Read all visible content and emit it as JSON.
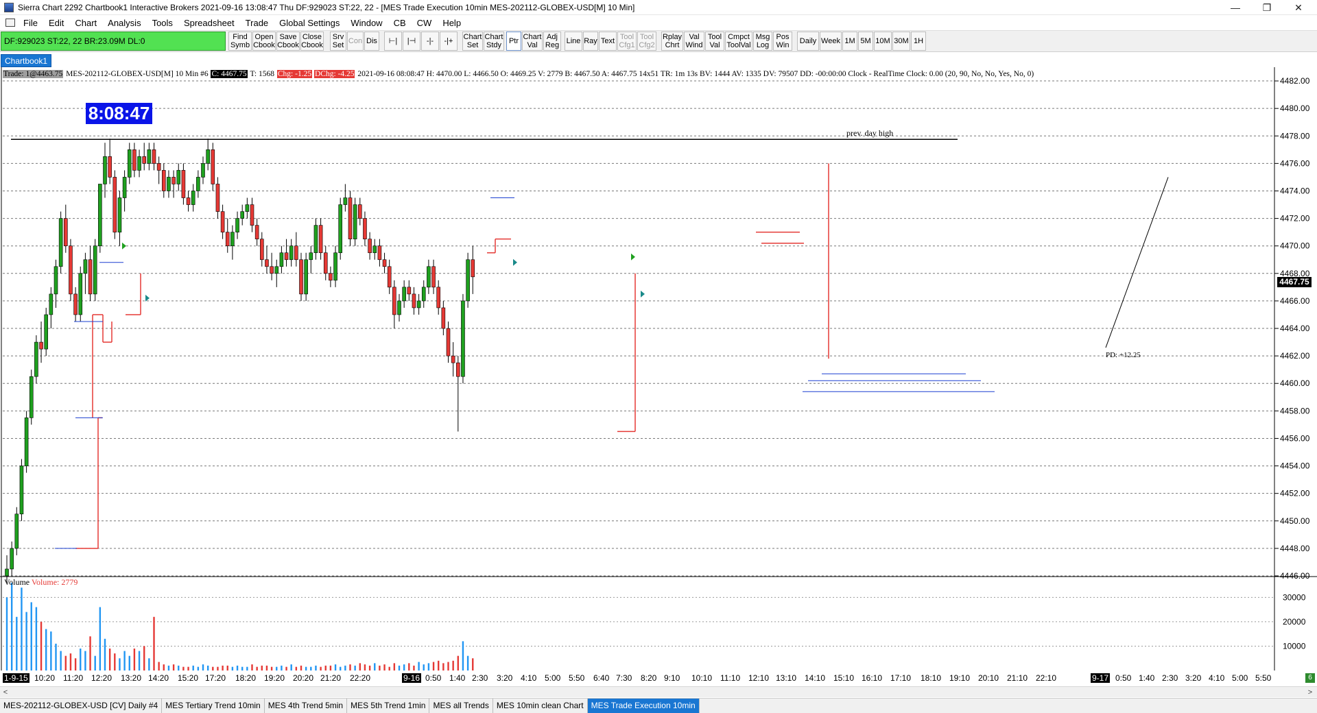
{
  "window": {
    "title": "Sierra Chart 2292 Chartbook1  Interactive Brokers 2021-09-16  13:08:47 Thu  DF:929023  ST:22, 22 - [MES Trade Execution 10min MES-202112-GLOBEX-USD[M]  10 Min]",
    "minimize": "—",
    "restore": "❐",
    "close": "✕"
  },
  "menu": [
    "File",
    "Edit",
    "Chart",
    "Analysis",
    "Tools",
    "Spreadsheet",
    "Trade",
    "Global Settings",
    "Window",
    "CB",
    "CW",
    "Help"
  ],
  "toolbar": {
    "status": "DF:929023  ST:22, 22  BR:23.09M  DL:0",
    "buttons": [
      {
        "label": "Find\nSymb"
      },
      {
        "label": "Open\nCbook"
      },
      {
        "label": "Save\nCbook"
      },
      {
        "label": "Close\nCbook"
      },
      {
        "label": "Srv\nSet"
      },
      {
        "label": "Con",
        "disabled": true
      },
      {
        "label": "Dis"
      },
      {
        "label": "⊢|",
        "icon": "zoom-left-icon"
      },
      {
        "label": "|⊣",
        "icon": "zoom-right-icon"
      },
      {
        "label": "-|-",
        "icon": "scroll-center-icon"
      },
      {
        "label": "-|+",
        "icon": "scroll-right-icon"
      },
      {
        "label": "Chart\nSet"
      },
      {
        "label": "Chart\nStdy"
      },
      {
        "label": "Ptr",
        "selected": true
      },
      {
        "label": "Chart\nVal"
      },
      {
        "label": "Adj\nReg"
      },
      {
        "label": "Line"
      },
      {
        "label": "Ray"
      },
      {
        "label": "Text"
      },
      {
        "label": "Tool\nCfg1",
        "disabled": true
      },
      {
        "label": "Tool\nCfg2",
        "disabled": true
      },
      {
        "label": "Rplay\nChrt"
      },
      {
        "label": "Val\nWind"
      },
      {
        "label": "Tool\nVal"
      },
      {
        "label": "Cmpct\nToolVal"
      },
      {
        "label": "Msg\nLog"
      },
      {
        "label": "Pos\nWin"
      },
      {
        "label": "Daily"
      },
      {
        "label": "Week"
      },
      {
        "label": "1M"
      },
      {
        "label": "5M"
      },
      {
        "label": "10M"
      },
      {
        "label": "30M"
      },
      {
        "label": "1H"
      }
    ]
  },
  "chartbook_tab": "Chartbook1",
  "info": {
    "trade": "Trade: 1@4463.75",
    "symbol": "MES-202112-GLOBEX-USD[M]   10 Min   #6",
    "close": "C: 4467.75",
    "ticks": "T: 1568",
    "chg": "Chg: -1.25",
    "dchg": "DChg: -4.25",
    "rest": "2021-09-16  08:08:47  H: 4470.00  L: 4466.50  O: 4469.25  V: 2779  B: 4467.50  A: 4467.75  14x51  TR: 1m 13s  BV: 1444  AV: 1335  DV: 79507  DD: -00:00:00  Clock - RealTime  Clock: 0.00   (20, 90, No, No, Yes, No, 0)"
  },
  "clock": "8:08:47",
  "annotations": {
    "prev_day_high": "prev. day high",
    "pd": "PD: +12.25"
  },
  "price_axis": {
    "labels": [
      "4482.00",
      "4480.00",
      "4478.00",
      "4476.00",
      "4474.00",
      "4472.00",
      "4470.00",
      "4468.00",
      "4466.00",
      "4464.00",
      "4462.00",
      "4460.00",
      "4458.00",
      "4456.00",
      "4454.00",
      "4452.00",
      "4450.00",
      "4448.00",
      "4446.00"
    ],
    "last_price": "4467.75"
  },
  "volume": {
    "label": "Volume",
    "value": "Volume: 2779",
    "axis_labels": [
      "30000",
      "20000",
      "10000"
    ]
  },
  "time_axis": {
    "labels": [
      "1-9-15",
      "10:20",
      "11:20",
      "12:20",
      "13:20",
      "14:20",
      "15:20",
      "17:20",
      "18:20",
      "19:20",
      "20:20",
      "21:20",
      "22:20",
      "9-16",
      "0:50",
      "1:40",
      "2:30",
      "3:20",
      "4:10",
      "5:00",
      "5:50",
      "6:40",
      "7:30",
      "8:20",
      "9:10",
      "10:10",
      "11:10",
      "12:10",
      "13:10",
      "14:10",
      "15:10",
      "16:10",
      "17:10",
      "18:10",
      "19:10",
      "20:10",
      "21:10",
      "22:10",
      "9-17",
      "0:50",
      "1:40",
      "2:30",
      "3:20",
      "4:10",
      "5:00",
      "5:50"
    ],
    "boxed": [
      "1-9-15",
      "9-16",
      "9-17"
    ],
    "corner": "6"
  },
  "bottom_tabs": [
    {
      "label": "MES-202112-GLOBEX-USD [CV]  Daily  #4"
    },
    {
      "label": "MES Tertiary Trend 10min"
    },
    {
      "label": "MES 4th Trend 5min"
    },
    {
      "label": "MES 5th Trend 1min"
    },
    {
      "label": "MES all Trends"
    },
    {
      "label": "MES 10min clean Chart"
    },
    {
      "label": "MES Trade Execution 10min",
      "active": true
    }
  ],
  "colors": {
    "up": "#1fa01f",
    "down": "#e53935",
    "accent": "#1976d2",
    "status": "#52e152"
  },
  "chart_data": {
    "type": "candlestick",
    "symbol": "MES-202112-GLOBEX-USD[M]",
    "interval": "10 Min",
    "ylim": [
      4446,
      4483
    ],
    "prev_day_high": 4477.75,
    "last": 4467.75,
    "candles": [
      [
        4446.0,
        4447.5,
        4445.5,
        4446.5
      ],
      [
        4446.5,
        4448.5,
        4446.0,
        4448.0
      ],
      [
        4448.0,
        4451.0,
        4447.5,
        4450.5
      ],
      [
        4450.5,
        4454.5,
        4450.0,
        4454.0
      ],
      [
        4454.0,
        4458.0,
        4453.5,
        4457.5
      ],
      [
        4457.5,
        4461.0,
        4457.0,
        4460.5
      ],
      [
        4460.5,
        4463.5,
        4460.0,
        4463.0
      ],
      [
        4463.0,
        4464.5,
        4461.5,
        4462.5
      ],
      [
        4462.5,
        4465.5,
        4462.0,
        4465.0
      ],
      [
        4465.0,
        4467.0,
        4464.0,
        4466.5
      ],
      [
        4466.5,
        4469.0,
        4465.5,
        4468.5
      ],
      [
        4468.5,
        4472.5,
        4468.0,
        4472.0
      ],
      [
        4472.0,
        4473.0,
        4469.5,
        4470.0
      ],
      [
        4470.0,
        4470.5,
        4466.0,
        4466.5
      ],
      [
        4466.5,
        4467.0,
        4464.5,
        4465.0
      ],
      [
        4465.0,
        4468.5,
        4464.5,
        4468.0
      ],
      [
        4468.0,
        4469.5,
        4466.5,
        4469.0
      ],
      [
        4469.0,
        4470.0,
        4466.0,
        4466.5
      ],
      [
        4466.5,
        4470.5,
        4466.0,
        4470.0
      ],
      [
        4470.0,
        4474.5,
        4469.5,
        4474.5
      ],
      [
        4474.5,
        4477.5,
        4473.5,
        4476.5
      ],
      [
        4476.5,
        4477.8,
        4474.5,
        4475.0
      ],
      [
        4475.0,
        4475.5,
        4470.5,
        4471.0
      ],
      [
        4471.0,
        4474.0,
        4470.0,
        4473.5
      ],
      [
        4473.5,
        4475.5,
        4472.5,
        4475.0
      ],
      [
        4475.0,
        4477.5,
        4474.5,
        4477.0
      ],
      [
        4477.0,
        4477.5,
        4475.0,
        4475.5
      ],
      [
        4475.5,
        4477.0,
        4475.0,
        4476.5
      ],
      [
        4476.5,
        4477.5,
        4475.5,
        4476.0
      ],
      [
        4476.0,
        4477.5,
        4475.5,
        4477.0
      ],
      [
        4477.0,
        4477.5,
        4475.5,
        4476.0
      ],
      [
        4476.0,
        4476.5,
        4474.5,
        4475.5
      ],
      [
        4475.5,
        4476.0,
        4473.5,
        4474.0
      ],
      [
        4474.0,
        4475.5,
        4473.5,
        4475.0
      ],
      [
        4475.0,
        4475.5,
        4473.5,
        4474.5
      ],
      [
        4474.5,
        4476.0,
        4474.0,
        4475.5
      ],
      [
        4475.5,
        4476.0,
        4473.0,
        4473.5
      ],
      [
        4473.5,
        4474.0,
        4472.5,
        4473.0
      ],
      [
        4473.0,
        4474.5,
        4472.5,
        4474.0
      ],
      [
        4474.0,
        4475.5,
        4473.5,
        4475.0
      ],
      [
        4475.0,
        4476.5,
        4474.5,
        4476.0
      ],
      [
        4476.0,
        4477.8,
        4475.5,
        4477.0
      ],
      [
        4477.0,
        4477.5,
        4474.0,
        4474.5
      ],
      [
        4474.5,
        4475.0,
        4472.0,
        4472.5
      ],
      [
        4472.5,
        4473.0,
        4470.5,
        4471.0
      ],
      [
        4471.0,
        4472.0,
        4469.5,
        4470.0
      ],
      [
        4470.0,
        4471.5,
        4469.0,
        4471.0
      ],
      [
        4471.0,
        4472.5,
        4470.5,
        4472.0
      ],
      [
        4472.0,
        4473.0,
        4471.5,
        4472.5
      ],
      [
        4472.5,
        4473.5,
        4472.0,
        4473.0
      ],
      [
        4473.0,
        4473.5,
        4471.0,
        4471.5
      ],
      [
        4471.5,
        4472.0,
        4470.0,
        4470.5
      ],
      [
        4470.5,
        4471.0,
        4468.5,
        4469.0
      ],
      [
        4469.0,
        4470.0,
        4468.0,
        4468.5
      ],
      [
        4468.5,
        4469.5,
        4467.5,
        4468.0
      ],
      [
        4468.0,
        4469.0,
        4467.0,
        4468.5
      ],
      [
        4468.5,
        4470.0,
        4468.0,
        4469.5
      ],
      [
        4469.5,
        4470.5,
        4468.5,
        4469.0
      ],
      [
        4469.0,
        4470.5,
        4468.5,
        4470.0
      ],
      [
        4470.0,
        4471.0,
        4468.5,
        4469.0
      ],
      [
        4469.0,
        4469.5,
        4466.0,
        4466.5
      ],
      [
        4466.5,
        4469.5,
        4466.0,
        4469.0
      ],
      [
        4469.0,
        4470.0,
        4468.0,
        4469.5
      ],
      [
        4469.5,
        4472.0,
        4469.0,
        4471.5
      ],
      [
        4471.5,
        4472.0,
        4469.0,
        4469.5
      ],
      [
        4469.5,
        4470.0,
        4467.5,
        4468.0
      ],
      [
        4468.0,
        4468.5,
        4467.0,
        4467.5
      ],
      [
        4467.5,
        4470.0,
        4467.0,
        4469.5
      ],
      [
        4469.5,
        4473.5,
        4469.0,
        4473.0
      ],
      [
        4473.0,
        4474.5,
        4472.5,
        4473.5
      ],
      [
        4473.5,
        4474.0,
        4470.0,
        4470.5
      ],
      [
        4470.5,
        4473.5,
        4470.0,
        4473.0
      ],
      [
        4473.0,
        4473.5,
        4471.5,
        4472.0
      ],
      [
        4472.0,
        4472.5,
        4470.0,
        4470.5
      ],
      [
        4470.5,
        4471.0,
        4469.0,
        4469.5
      ],
      [
        4469.5,
        4470.5,
        4469.0,
        4470.0
      ],
      [
        4470.0,
        4470.5,
        4468.5,
        4469.0
      ],
      [
        4469.0,
        4469.5,
        4468.0,
        4468.5
      ],
      [
        4468.5,
        4469.0,
        4466.5,
        4467.0
      ],
      [
        4467.0,
        4467.5,
        4464.0,
        4465.0
      ],
      [
        4465.0,
        4466.5,
        4464.5,
        4466.0
      ],
      [
        4466.0,
        4467.5,
        4465.5,
        4467.0
      ],
      [
        4467.0,
        4467.5,
        4466.0,
        4466.5
      ],
      [
        4466.5,
        4467.0,
        4465.0,
        4465.5
      ],
      [
        4465.5,
        4466.5,
        4465.0,
        4466.0
      ],
      [
        4466.0,
        4467.5,
        4465.5,
        4467.0
      ],
      [
        4467.0,
        4469.0,
        4466.5,
        4468.5
      ],
      [
        4468.5,
        4469.0,
        4466.5,
        4467.0
      ],
      [
        4467.0,
        4467.5,
        4465.0,
        4465.5
      ],
      [
        4465.5,
        4466.0,
        4463.5,
        4464.0
      ],
      [
        4464.0,
        4464.5,
        4461.5,
        4462.0
      ],
      [
        4462.0,
        4463.0,
        4460.5,
        4461.5
      ],
      [
        4461.5,
        4462.0,
        4456.5,
        4460.5
      ],
      [
        4460.5,
        4466.5,
        4460.0,
        4466.0
      ],
      [
        4466.0,
        4469.5,
        4465.5,
        4469.0
      ],
      [
        4469.0,
        4470.0,
        4466.5,
        4467.75
      ]
    ],
    "volume_max": 36000,
    "volumes": [
      30000,
      36000,
      22000,
      34000,
      24000,
      28000,
      26000,
      20000,
      17000,
      16000,
      11000,
      8000,
      6000,
      7000,
      5000,
      9000,
      8000,
      14000,
      6000,
      26000,
      13000,
      9000,
      7000,
      5000,
      8000,
      6000,
      9000,
      8000,
      10000,
      5000,
      22000,
      3500,
      2500,
      2000,
      2500,
      2000,
      1500,
      1500,
      2000,
      1500,
      2500,
      2000,
      1500,
      1500,
      2000,
      2000,
      1500,
      2000,
      1500,
      1500,
      2500,
      1500,
      2000,
      2000,
      1500,
      1500,
      2000,
      1500,
      2500,
      1500,
      2000,
      1500,
      1500,
      2000,
      1500,
      2000,
      2000,
      2500,
      1500,
      2000,
      2500,
      2000,
      3000,
      2500,
      2000,
      3000,
      2000,
      2500,
      1500,
      3000,
      2000,
      2500,
      3000,
      2000,
      3500,
      2500,
      3000,
      3500,
      4000,
      3000,
      3500,
      4000,
      6000,
      12000,
      6000,
      5000
    ]
  }
}
